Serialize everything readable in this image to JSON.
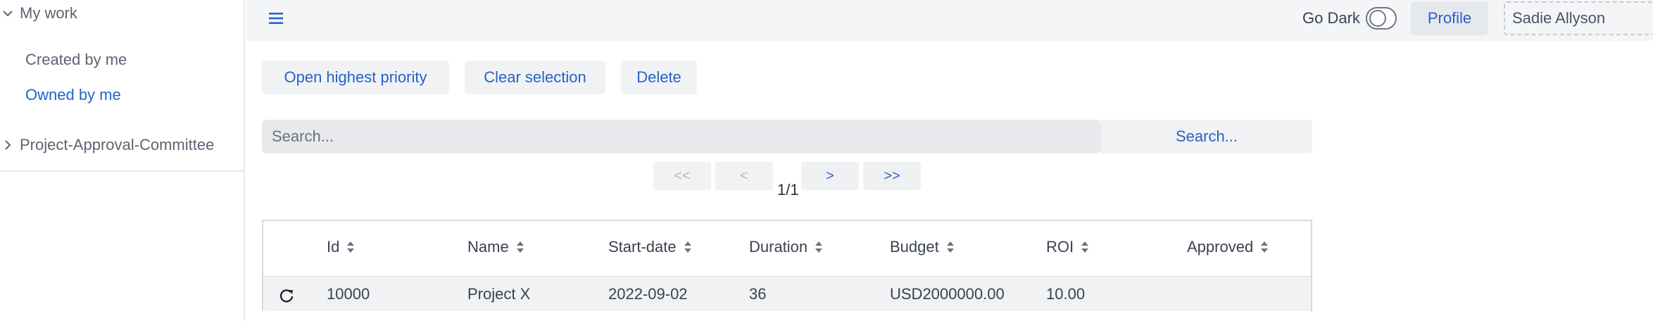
{
  "sidebar": {
    "groups": [
      {
        "label": "My work",
        "expanded": true
      },
      {
        "label": "Project-Approval-Committee",
        "expanded": false
      }
    ],
    "items": [
      {
        "label": "Created by me",
        "active": false
      },
      {
        "label": "Owned by me",
        "active": true
      }
    ]
  },
  "header": {
    "menu_icon": "hamburger-menu-icon",
    "go_dark_label": "Go Dark",
    "dark_mode_on": false,
    "profile_label": "Profile",
    "user_name": "Sadie Allyson"
  },
  "actions": {
    "open_highest_priority": "Open highest priority",
    "clear_selection": "Clear selection",
    "delete": "Delete"
  },
  "search": {
    "placeholder": "Search...",
    "button_label": "Search..."
  },
  "pager": {
    "first": "<<",
    "prev": "<",
    "next": ">",
    "last": ">>",
    "info": "1/1"
  },
  "table": {
    "columns": [
      "Id",
      "Name",
      "Start-date",
      "Duration",
      "Budget",
      "ROI",
      "Approved"
    ],
    "rows": [
      {
        "id": "10000",
        "name": "Project X",
        "start_date": "2022-09-02",
        "duration": "36",
        "budget": "USD2000000.00",
        "roi": "10.00",
        "approved": ""
      }
    ]
  },
  "colors": {
    "accent": "#2563c9",
    "topbar_bg": "#f4f5f7",
    "button_bg": "#f1f2f4"
  }
}
